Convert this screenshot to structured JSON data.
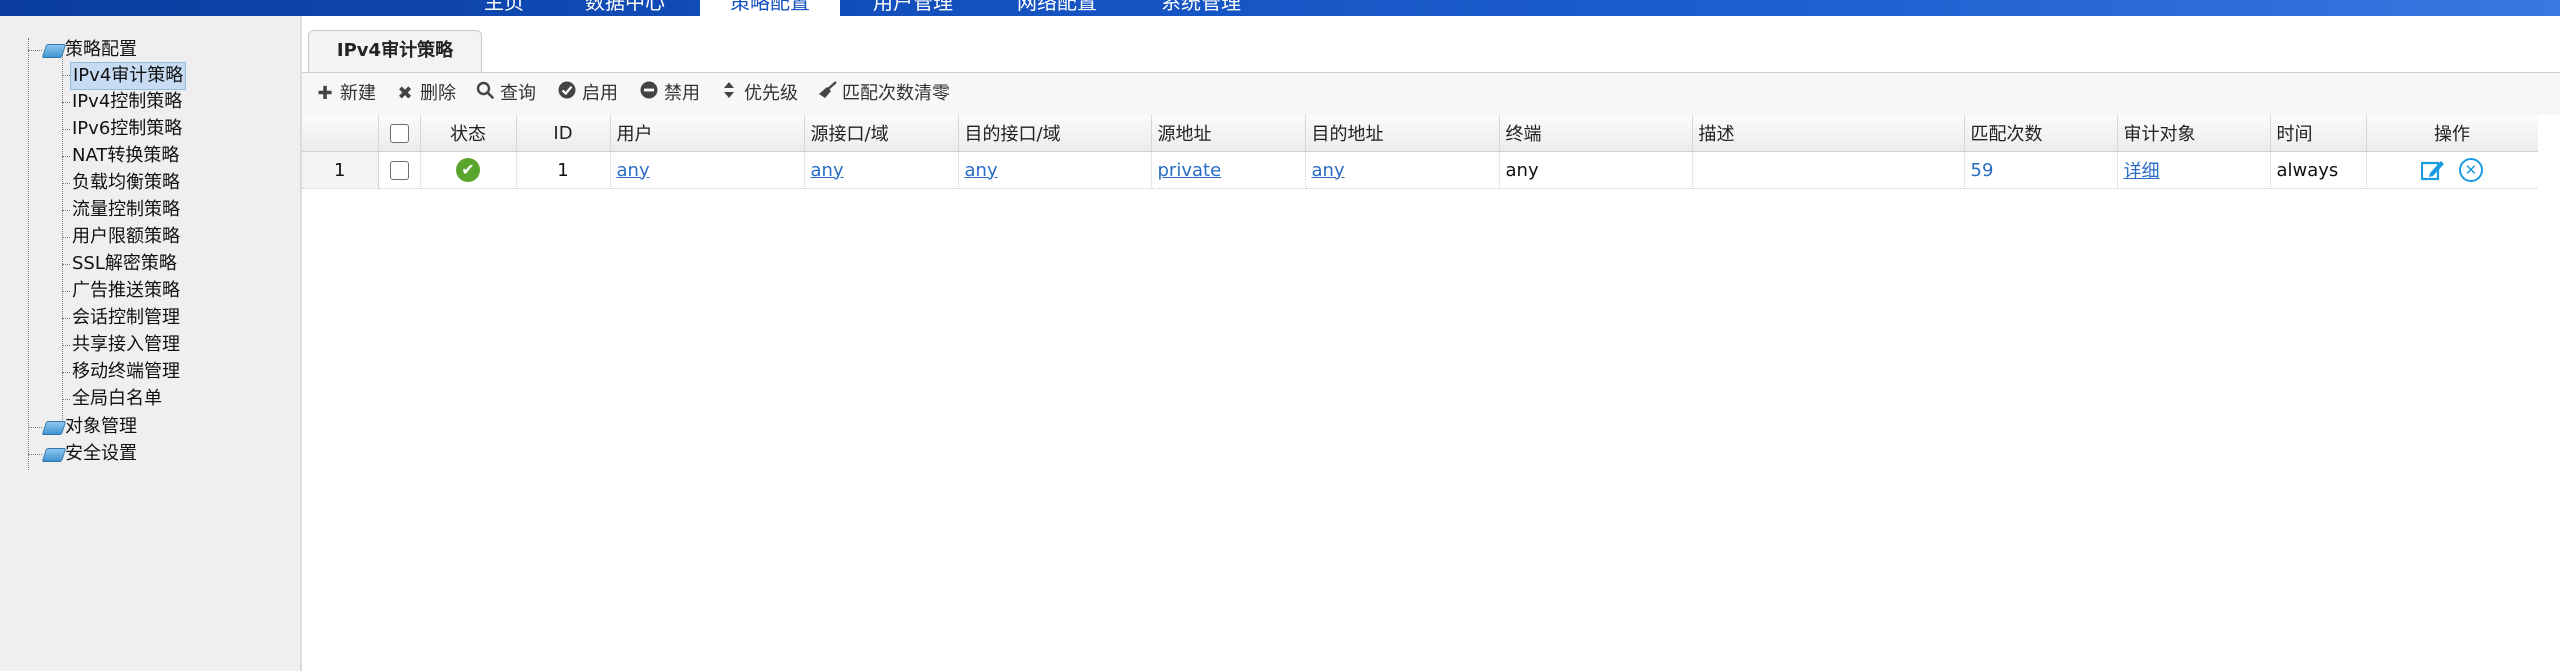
{
  "nav": {
    "items": [
      {
        "label": "主页"
      },
      {
        "label": "数据中心"
      },
      {
        "label": "策略配置",
        "active": true
      },
      {
        "label": "用户管理"
      },
      {
        "label": "网络配置"
      },
      {
        "label": "系统管理"
      }
    ]
  },
  "sidebar": {
    "roots": [
      {
        "label": "策略配置",
        "icon": "folder-icon"
      },
      {
        "label": "对象管理",
        "icon": "folder-icon"
      },
      {
        "label": "安全设置",
        "icon": "folder-icon"
      }
    ],
    "children": [
      {
        "label": "IPv4审计策略",
        "selected": true
      },
      {
        "label": "IPv4控制策略"
      },
      {
        "label": "IPv6控制策略"
      },
      {
        "label": "NAT转换策略"
      },
      {
        "label": "负载均衡策略"
      },
      {
        "label": "流量控制策略"
      },
      {
        "label": "用户限额策略"
      },
      {
        "label": "SSL解密策略"
      },
      {
        "label": "广告推送策略"
      },
      {
        "label": "会话控制管理"
      },
      {
        "label": "共享接入管理"
      },
      {
        "label": "移动终端管理"
      },
      {
        "label": "全局白名单"
      }
    ]
  },
  "tab": {
    "label": "IPv4审计策略"
  },
  "toolbar": {
    "new": "新建",
    "delete": "删除",
    "query": "查询",
    "enable": "启用",
    "disable": "禁用",
    "priority": "优先级",
    "clear_count": "匹配次数清零"
  },
  "table": {
    "headers": {
      "status": "状态",
      "id": "ID",
      "user": "用户",
      "src_if": "源接口/域",
      "dst_if": "目的接口/域",
      "src_addr": "源地址",
      "dst_addr": "目的地址",
      "terminal": "终端",
      "desc": "描述",
      "match_count": "匹配次数",
      "audit_obj": "审计对象",
      "time": "时间",
      "ops": "操作"
    },
    "rows": [
      {
        "rownum": "1",
        "status": "enabled",
        "id": "1",
        "user": "any",
        "src_if": "any",
        "dst_if": "any",
        "src_addr": "private",
        "dst_addr": "any",
        "terminal": "any",
        "desc": "",
        "match_count": "59",
        "audit_obj": "详细",
        "time": "always"
      }
    ]
  },
  "colors": {
    "link": "#2a6cc4",
    "status_ok": "#5aa52c",
    "nav_bg": "#1452c0",
    "selected_bg": "#c7dcf2"
  }
}
